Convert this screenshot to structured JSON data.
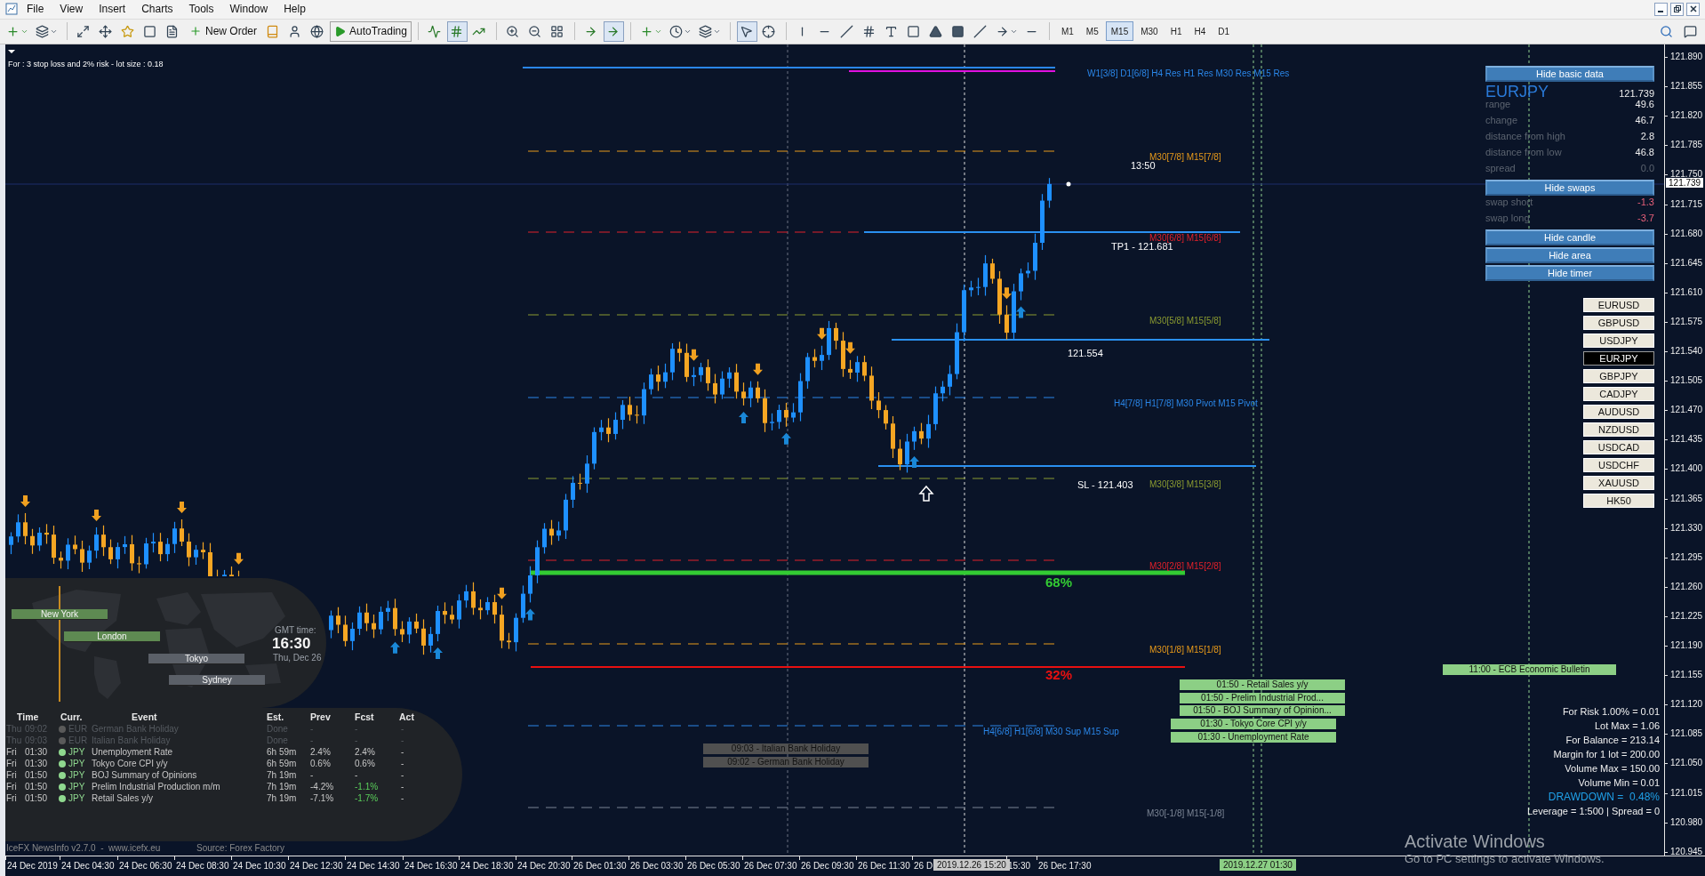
{
  "menu_bar": {
    "items": [
      "File",
      "View",
      "Insert",
      "Charts",
      "Tools",
      "Window",
      "Help"
    ]
  },
  "toolbar": {
    "new_order": "New Order",
    "autotrading": "AutoTrading",
    "timeframes": [
      {
        "label": "M1",
        "selected": false
      },
      {
        "label": "M5",
        "selected": false
      },
      {
        "label": "M15",
        "selected": true
      },
      {
        "label": "M30",
        "selected": false
      },
      {
        "label": "H1",
        "selected": false
      },
      {
        "label": "H4",
        "selected": false
      },
      {
        "label": "D1",
        "selected": false
      }
    ]
  },
  "chart": {
    "info_text": "For : 3 stop loss and 2% risk - lot size : 0.18",
    "resistance": {
      "label": "W1[3/8] D1[6/8] H4 Res H1 Res M30 Res M15 Res",
      "color": "#2a86e8"
    },
    "pivot_levels": [
      {
        "label": "M30[7/8] M15[7/8]",
        "color": "#e89a1a"
      },
      {
        "label": "M30[6/8] M15[6/8]",
        "color": "#e0202a"
      },
      {
        "label": "M30[5/8] M15[5/8]",
        "color": "#8a9a30"
      },
      {
        "label": "H4[7/8] H1[7/8] M30 Pivot M15 Pivot",
        "color": "#2a86e8"
      },
      {
        "label": "M30[3/8] M15[3/8]",
        "color": "#8a9a30"
      },
      {
        "label": "M30[2/8] M15[2/8]",
        "color": "#e0202a"
      },
      {
        "label": "M30[1/8] M15[1/8]",
        "color": "#e89a1a"
      },
      {
        "label": "H4[6/8] H1[6/8] M30 Sup M15 Sup",
        "color": "#2a86e8"
      },
      {
        "label": "M30[-1/8] M15[-1/8]",
        "color": "#7a8494"
      }
    ],
    "trade_lines": [
      {
        "label": "TP1 - 121.681"
      },
      {
        "label": "121.554"
      },
      {
        "label": "SL - 121.403"
      }
    ],
    "zones": [
      {
        "label": "68%",
        "color": "#33cc33"
      },
      {
        "label": "32%",
        "color": "#e81010"
      }
    ],
    "candle_timer": "13:50",
    "news_markers": [
      {
        "text": "09:03 - Italian Bank Holiday",
        "past": true
      },
      {
        "text": "09:02 - German Bank Holiday",
        "past": true
      },
      {
        "text": "01:50 - Retail Sales y/y",
        "past": false
      },
      {
        "text": "01:50 - Prelim Industrial Prod...",
        "past": false
      },
      {
        "text": "01:50 - BOJ Summary of Opinion...",
        "past": false
      },
      {
        "text": "01:30 - Tokyo Core CPI y/y",
        "past": false
      },
      {
        "text": "01:30 - Unemployment Rate",
        "past": false
      },
      {
        "text": "11:00 - ECB Economic Bulletin",
        "past": false
      }
    ],
    "market_panel": {
      "basic_toggle": "Hide basic data",
      "symbol": "EURJPY",
      "price": "121.739",
      "stats": [
        {
          "label": "range",
          "value": "49.6",
          "muted": false
        },
        {
          "label": "change",
          "value": "46.7",
          "muted": false
        },
        {
          "label": "distance from high",
          "value": "2.8",
          "muted": false
        },
        {
          "label": "distance from low",
          "value": "46.8",
          "muted": false
        },
        {
          "label": "spread",
          "value": "0.0",
          "muted": true
        }
      ],
      "swap_toggle": "Hide swaps",
      "swaps": [
        {
          "label": "swap short",
          "value": "-1.3"
        },
        {
          "label": "swap long",
          "value": "-3.7"
        }
      ],
      "toggles": [
        "Hide candle",
        "Hide area",
        "Hide timer"
      ],
      "symbols": [
        {
          "label": "EURUSD",
          "selected": false
        },
        {
          "label": "GBPUSD",
          "selected": false
        },
        {
          "label": "USDJPY",
          "selected": false
        },
        {
          "label": "EURJPY",
          "selected": true
        },
        {
          "label": "GBPJPY",
          "selected": false
        },
        {
          "label": "CADJPY",
          "selected": false
        },
        {
          "label": "AUDUSD",
          "selected": false
        },
        {
          "label": "NZDUSD",
          "selected": false
        },
        {
          "label": "USDCAD",
          "selected": false
        },
        {
          "label": "USDCHF",
          "selected": false
        },
        {
          "label": "XAUUSD",
          "selected": false
        },
        {
          "label": "HK50",
          "selected": false
        }
      ]
    },
    "risk_info": [
      {
        "text": "For Risk 1.00% = 0.01",
        "kind": "plain"
      },
      {
        "text": "Lot Max = 1.06",
        "kind": "plain"
      },
      {
        "text": "For Balance = 213.14",
        "kind": "plain"
      },
      {
        "text": "Margin for 1 lot = 200.00",
        "kind": "plain"
      },
      {
        "text": "Volume Max = 150.00",
        "kind": "plain"
      },
      {
        "text": "Volume Min = 0.01",
        "kind": "plain"
      },
      {
        "text": "DRAWDOWN =  0.48%",
        "kind": "highlight"
      },
      {
        "text": "Leverage = 1:500 | Spread = 0",
        "kind": "plain"
      }
    ],
    "sessions": {
      "cities": [
        {
          "name": "New York",
          "active": true
        },
        {
          "name": "London",
          "active": true
        },
        {
          "name": "Tokyo",
          "active": false
        },
        {
          "name": "Sydney",
          "active": false
        }
      ],
      "gmt_label": "GMT time:",
      "gmt_time": "16:30",
      "date": "Thu, Dec 26"
    },
    "news": {
      "columns": [
        "Time",
        "Curr.",
        "Event",
        "Est.",
        "Prev",
        "Fcst",
        "Act"
      ],
      "rows": [
        {
          "day": "Thu",
          "time": "09:02",
          "color": "#5a5a5a",
          "currency": "EUR",
          "event": "German Bank Holiday",
          "est": "Done",
          "prev": "-",
          "fcst": "-",
          "act": "-",
          "past": true,
          "fcst_better": false
        },
        {
          "day": "Thu",
          "time": "09:03",
          "color": "#5a5a5a",
          "currency": "EUR",
          "event": "Italian Bank Holiday",
          "est": "Done",
          "prev": "-",
          "fcst": "-",
          "act": "-",
          "past": true,
          "fcst_better": false
        },
        {
          "day": "Fri",
          "time": "01:30",
          "color": "#8fd88f",
          "currency": "JPY",
          "event": "Unemployment Rate",
          "est": "6h 59m",
          "prev": "2.4%",
          "fcst": "2.4%",
          "act": "-",
          "past": false,
          "fcst_better": false
        },
        {
          "day": "Fri",
          "time": "01:30",
          "color": "#8fd88f",
          "currency": "JPY",
          "event": "Tokyo Core CPI y/y",
          "est": "6h 59m",
          "prev": "0.6%",
          "fcst": "0.6%",
          "act": "-",
          "past": false,
          "fcst_better": false
        },
        {
          "day": "Fri",
          "time": "01:50",
          "color": "#8fd88f",
          "currency": "JPY",
          "event": "BOJ Summary of Opinions",
          "est": "7h 19m",
          "prev": "-",
          "fcst": "-",
          "act": "-",
          "past": false,
          "fcst_better": false
        },
        {
          "day": "Fri",
          "time": "01:50",
          "color": "#8fd88f",
          "currency": "JPY",
          "event": "Prelim Industrial Production m/m",
          "est": "7h 19m",
          "prev": "-4.2%",
          "fcst": "-1.1%",
          "act": "-",
          "past": false,
          "fcst_better": true
        },
        {
          "day": "Fri",
          "time": "01:50",
          "color": "#8fd88f",
          "currency": "JPY",
          "event": "Retail Sales y/y",
          "est": "7h 19m",
          "prev": "-7.1%",
          "fcst": "-1.7%",
          "act": "-",
          "past": false,
          "fcst_better": true
        }
      ],
      "footer": "IceFX NewsInfo v2.7.0  -  www.icefx.eu",
      "source": "Source: Forex Factory"
    }
  },
  "price_axis": {
    "labels": [
      "121.890",
      "121.855",
      "121.820",
      "121.785",
      "121.750",
      "121.715",
      "121.680",
      "121.645",
      "121.610",
      "121.575",
      "121.540",
      "121.505",
      "121.470",
      "121.435",
      "121.400",
      "121.365",
      "121.330",
      "121.295",
      "121.260",
      "121.225",
      "121.190",
      "121.155",
      "121.120",
      "121.085",
      "121.050",
      "121.015",
      "120.980",
      "120.945"
    ],
    "current": "121.739"
  },
  "time_axis": {
    "labels": [
      "24 Dec 2019",
      "24 Dec 04:30",
      "24 Dec 06:30",
      "24 Dec 08:30",
      "24 Dec 10:30",
      "24 Dec 12:30",
      "24 Dec 14:30",
      "24 Dec 16:30",
      "24 Dec 18:30",
      "24 Dec 20:30",
      "26 Dec 01:30",
      "26 Dec 03:30",
      "26 Dec 05:30",
      "26 Dec 07:30",
      "26 Dec 09:30",
      "26 Dec 11:30",
      "26 D",
      "15:30",
      "26 Dec 17:30"
    ],
    "cursor": "2019.12.26 15:20",
    "event_time": "2019.12.27 01:30"
  },
  "os_notice": {
    "title": "Activate Windows",
    "subtitle": "Go to PC settings to activate Windows."
  }
}
